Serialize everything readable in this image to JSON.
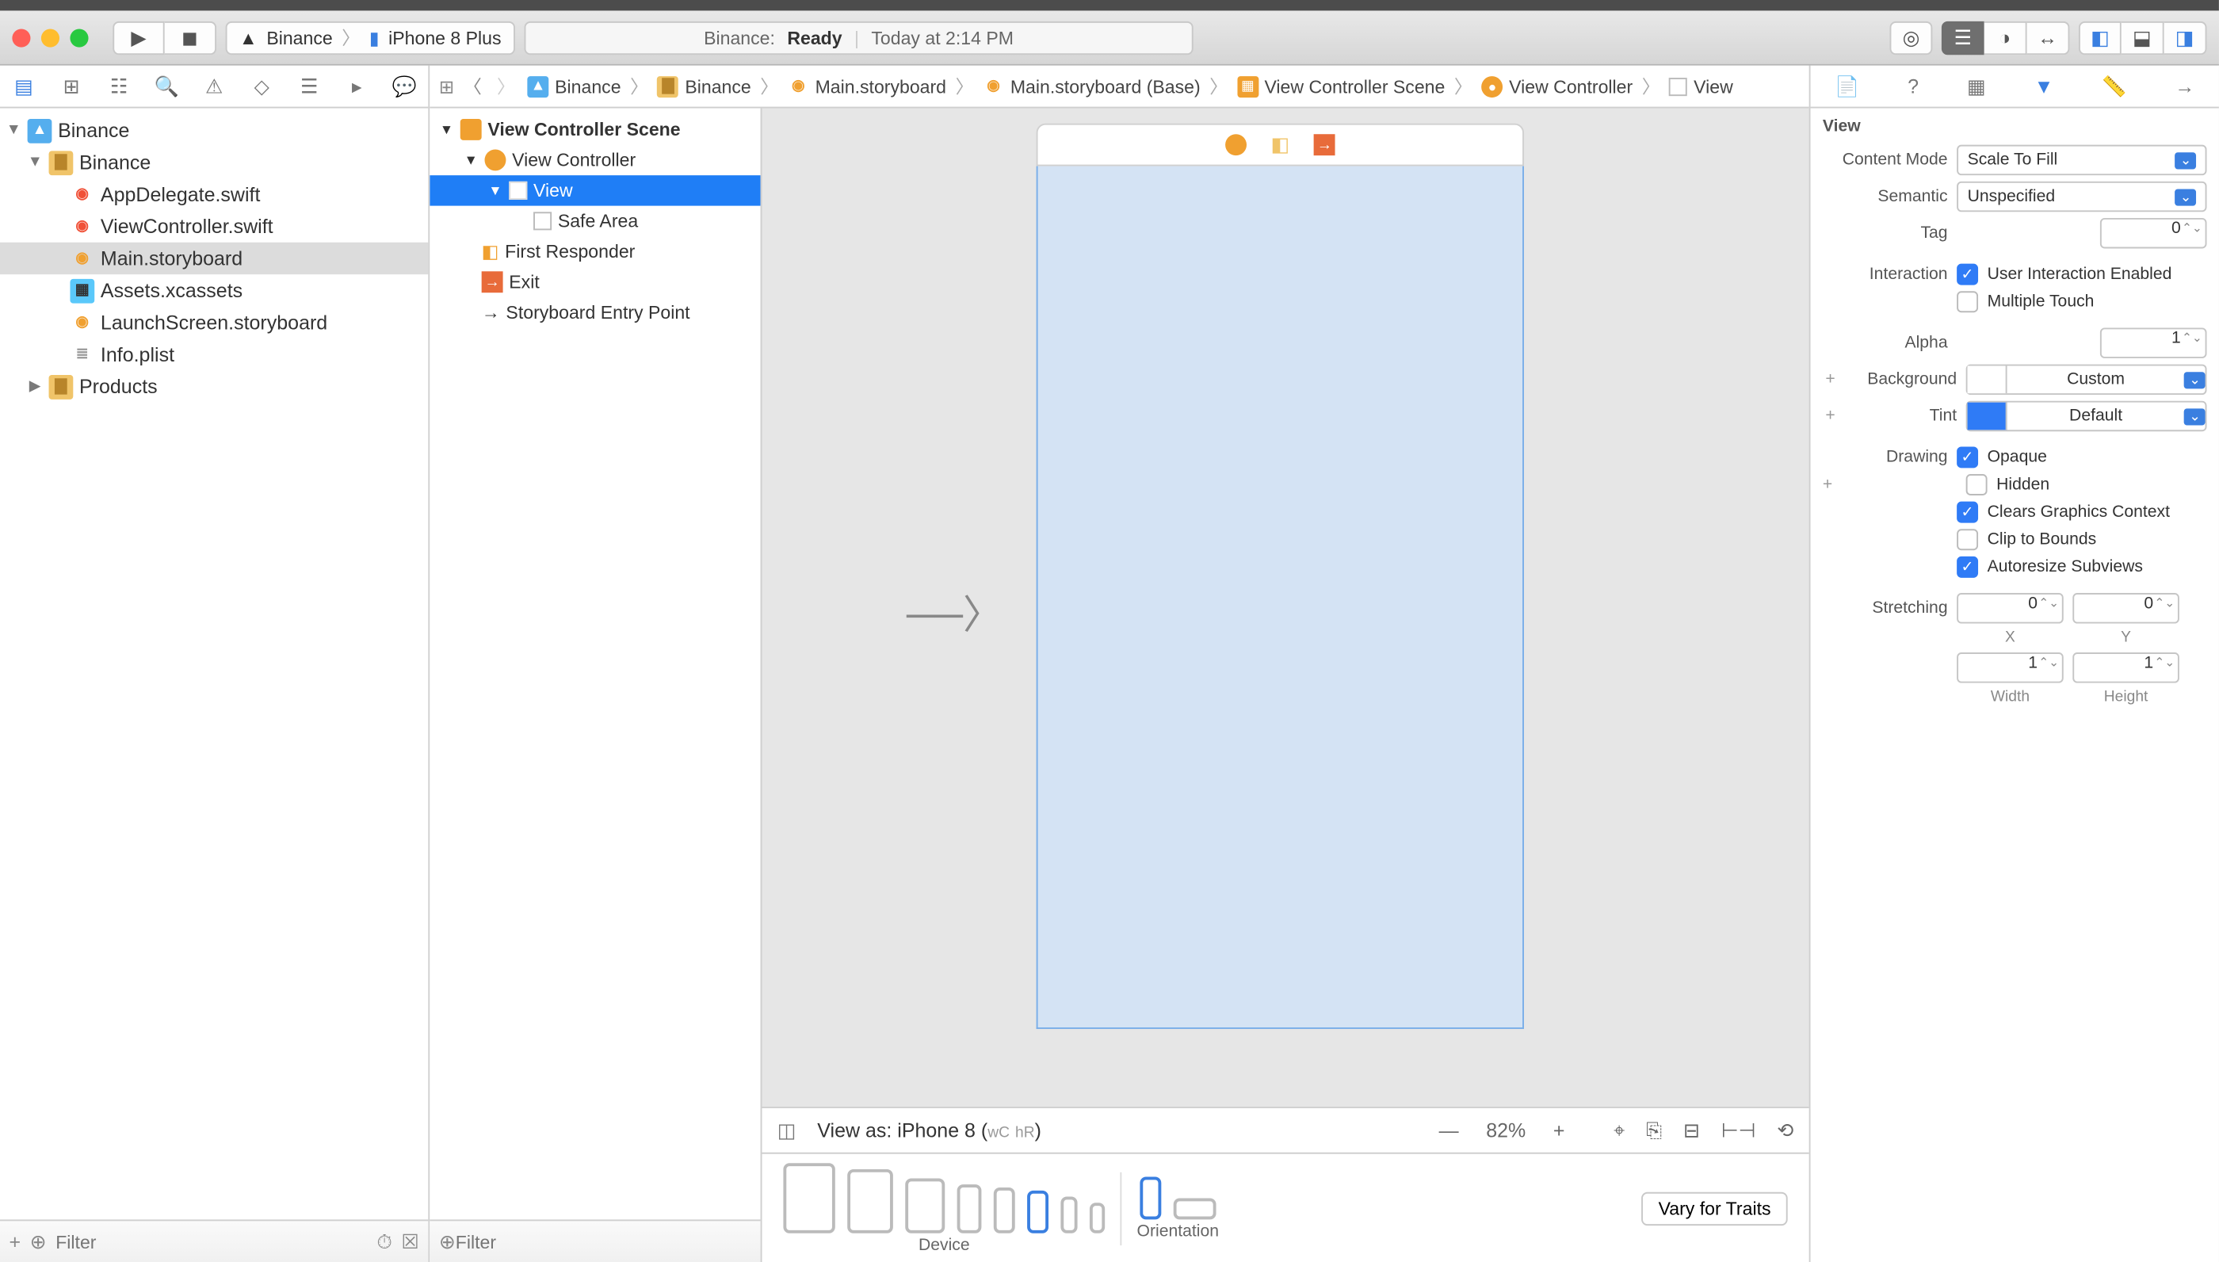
{
  "toolbar": {
    "scheme_app": "Binance",
    "scheme_device": "iPhone 8 Plus",
    "status_project": "Binance:",
    "status_state": "Ready",
    "status_time": "Today at 2:14 PM"
  },
  "navigator": {
    "project": "Binance",
    "group": "Binance",
    "files": [
      {
        "name": "AppDelegate.swift",
        "kind": "swift"
      },
      {
        "name": "ViewController.swift",
        "kind": "swift"
      },
      {
        "name": "Main.storyboard",
        "kind": "sb",
        "selected": true
      },
      {
        "name": "Assets.xcassets",
        "kind": "assets"
      },
      {
        "name": "LaunchScreen.storyboard",
        "kind": "sb"
      },
      {
        "name": "Info.plist",
        "kind": "plist"
      }
    ],
    "products": "Products",
    "filter_placeholder": "Filter"
  },
  "jumpbar": [
    "Binance",
    "Binance",
    "Main.storyboard",
    "Main.storyboard (Base)",
    "View Controller Scene",
    "View Controller",
    "View"
  ],
  "outline": {
    "scene": "View Controller Scene",
    "items": [
      {
        "label": "View Controller",
        "indent": 1,
        "kind": "vc"
      },
      {
        "label": "View",
        "indent": 2,
        "kind": "view",
        "selected": true
      },
      {
        "label": "Safe Area",
        "indent": 3,
        "kind": "safe"
      },
      {
        "label": "First Responder",
        "indent": 1,
        "kind": "fr"
      },
      {
        "label": "Exit",
        "indent": 1,
        "kind": "exit"
      },
      {
        "label": "Storyboard Entry Point",
        "indent": 1,
        "kind": "entry"
      }
    ],
    "filter_placeholder": "Filter"
  },
  "canvas": {
    "view_as": "View as: iPhone 8 (",
    "view_as_wc": "wC",
    "view_as_hr": "hR",
    "view_as_close": ")",
    "zoom": "82%",
    "device_label": "Device",
    "orientation_label": "Orientation",
    "vary_traits": "Vary for Traits"
  },
  "inspector": {
    "header": "View",
    "content_mode_label": "Content Mode",
    "content_mode": "Scale To Fill",
    "semantic_label": "Semantic",
    "semantic": "Unspecified",
    "tag_label": "Tag",
    "tag": "0",
    "interaction_label": "Interaction",
    "user_interaction": "User Interaction Enabled",
    "multiple_touch": "Multiple Touch",
    "alpha_label": "Alpha",
    "alpha": "1",
    "background_label": "Background",
    "background": "Custom",
    "tint_label": "Tint",
    "tint": "Default",
    "drawing_label": "Drawing",
    "opaque": "Opaque",
    "hidden": "Hidden",
    "clears": "Clears Graphics Context",
    "clip": "Clip to Bounds",
    "autoresize": "Autoresize Subviews",
    "stretching_label": "Stretching",
    "stretch_x": "0",
    "stretch_y": "0",
    "stretch_x_cap": "X",
    "stretch_y_cap": "Y",
    "stretch_w": "1",
    "stretch_h": "1",
    "stretch_w_cap": "Width",
    "stretch_h_cap": "Height"
  }
}
